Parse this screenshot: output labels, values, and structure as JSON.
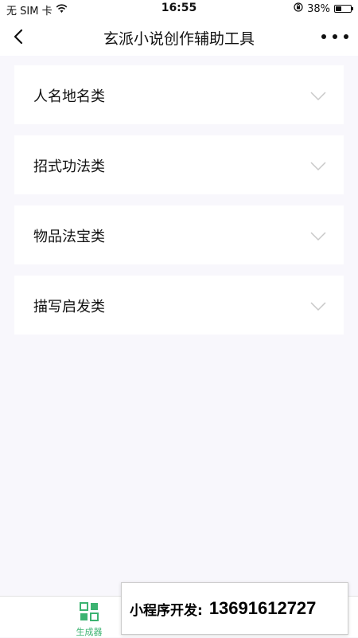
{
  "status_bar": {
    "carrier": "无 SIM 卡",
    "time": "16:55",
    "battery_percent": "38%",
    "battery_level": 0.38,
    "icons": [
      "wifi-icon",
      "orientation-lock-icon",
      "battery-icon"
    ]
  },
  "nav": {
    "title": "玄派小说创作辅助工具",
    "back_icon": "chevron-left-icon",
    "more_icon": "more-horizontal-icon"
  },
  "categories": [
    {
      "label": "人名地名类",
      "icon": "chevron-down-icon"
    },
    {
      "label": "招式功法类",
      "icon": "chevron-down-icon"
    },
    {
      "label": "物品法宝类",
      "icon": "chevron-down-icon"
    },
    {
      "label": "描写启发类",
      "icon": "chevron-down-icon"
    }
  ],
  "tab_bar": {
    "items": [
      {
        "label": "生成器",
        "icon": "grid-icon",
        "active": true
      }
    ],
    "accent_color": "#3cb371"
  },
  "promo": {
    "label": "小程序开发:",
    "phone": "13691612727"
  }
}
